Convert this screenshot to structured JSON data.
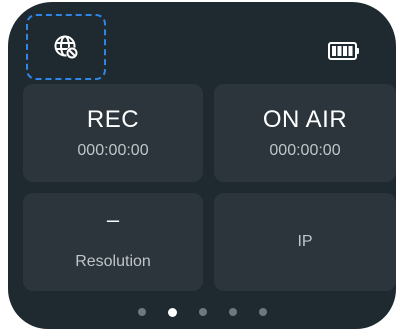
{
  "status_bar": {
    "left_icon": "globe-blocked-icon",
    "right_icon": "battery-full-icon",
    "battery_level": 1.0
  },
  "tiles": {
    "rec": {
      "title": "REC",
      "time": "000:00:00"
    },
    "on_air": {
      "title": "ON AIR",
      "time": "000:00:00"
    },
    "resolution": {
      "value": "–",
      "label": "Resolution"
    },
    "ip": {
      "label": "IP"
    }
  },
  "pagination": {
    "count": 5,
    "active_index": 1
  },
  "colors": {
    "screen_bg": "#1f2a30",
    "tile_bg": "#2b353b",
    "focus_outline": "#2f86e6",
    "text_primary": "#ffffff",
    "text_secondary": "#bfc5c9"
  }
}
